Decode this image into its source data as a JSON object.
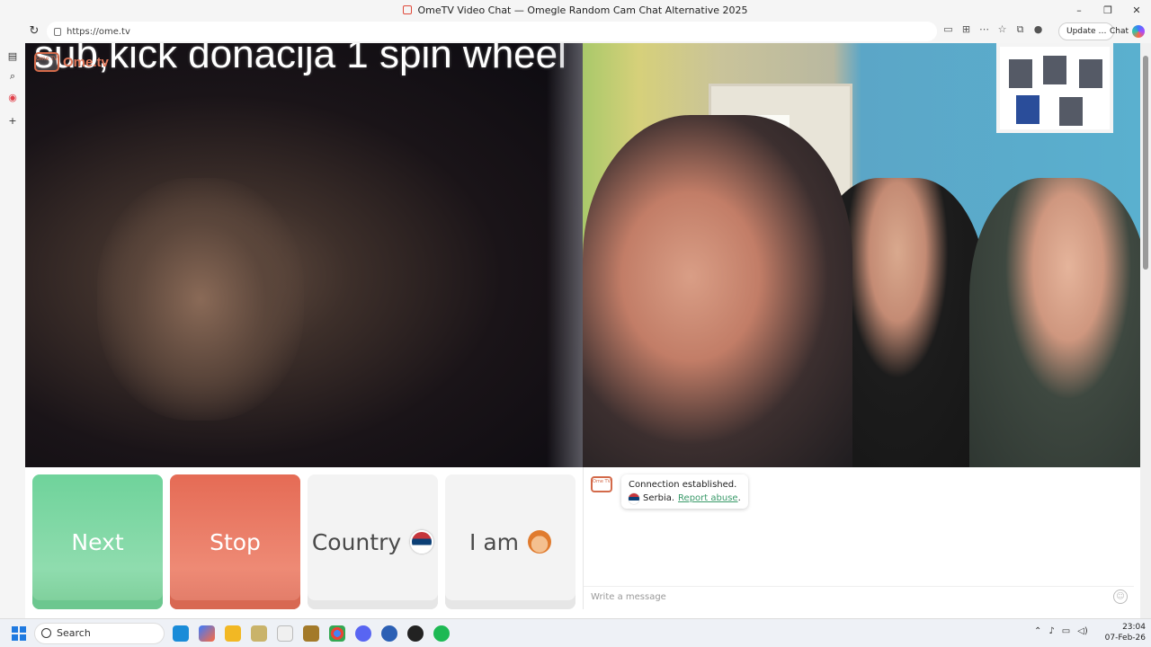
{
  "window": {
    "title": "OmeTV Video Chat — Omegle Random Cam Chat Alternative 2025",
    "controls": [
      "–",
      "❐",
      "✕"
    ]
  },
  "browser": {
    "url": "https://ome.tv",
    "update_label": "Update",
    "update_more": "…",
    "chat_label": "Chat"
  },
  "video": {
    "overlay_text": "sub,kick donacija 1 spin wheel",
    "logo_badge": "Ome TV",
    "logo_word": "Ome.tv"
  },
  "controls": {
    "next_label": "Next",
    "stop_label": "Stop",
    "country_label": "Country",
    "iam_label": "I am"
  },
  "chat": {
    "logo_badge": "Ome TV",
    "status_message": "Connection established.",
    "country_text": "Serbia.",
    "report_link": "Report abuse",
    "report_tail": ".",
    "input_placeholder": "Write a message"
  },
  "taskbar": {
    "search_placeholder": "Search",
    "time": "23:04",
    "date": "07-Feb-26"
  },
  "colors": {
    "next": "#7ed8a3",
    "stop": "#ea7a64",
    "neutral_button": "#f3f3f3",
    "link": "#3a9a6a"
  }
}
